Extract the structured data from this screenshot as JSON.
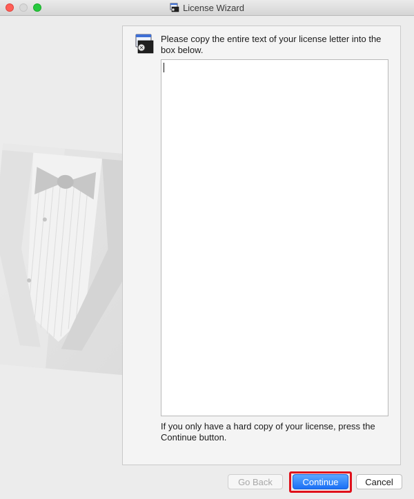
{
  "window": {
    "title": "License Wizard"
  },
  "panel": {
    "instruction": "Please copy the entire text of your license letter into the box below.",
    "license_text_value": "",
    "footnote": "If you only have a hard copy of your license, press the Continue button."
  },
  "buttons": {
    "back_label": "Go Back",
    "continue_label": "Continue",
    "cancel_label": "Cancel"
  },
  "icons": {
    "title_icon": "license-wizard-icon",
    "panel_icon": "license-document-icon",
    "illustration": "tuxedo-illustration"
  },
  "colors": {
    "accent": "#1a6ff5",
    "highlight_ring": "#e0101a"
  }
}
